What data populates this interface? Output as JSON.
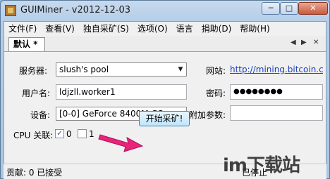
{
  "window": {
    "title": "GUIMiner - v2012-12-03",
    "min_label": "─",
    "max_label": "□",
    "close_label": "✕"
  },
  "menu": [
    "文件(F)",
    "查看(V)",
    "独自采矿(S)",
    "选项(O)",
    "语言",
    "捐助(D)",
    "帮助(H)"
  ],
  "tab": {
    "label": "默认 *",
    "prev": "◀",
    "next": "▶",
    "close": "✕"
  },
  "form": {
    "server_label": "服务器:",
    "server_value": "slush's pool",
    "website_label": "网站:",
    "website_value": "http://mining.bitcoin.cz",
    "username_label": "用户名:",
    "username_value": "ldjzll.worker1",
    "password_label": "密码:",
    "password_value": "●●●●●●●●",
    "device_label": "设备:",
    "device_value": "[0-0] GeForce 8400M GS",
    "extra_label": "附加参数:",
    "extra_value": "",
    "cpu_label": "CPU 关联:",
    "cpu0_label": "0",
    "cpu1_label": "1",
    "start_button": "开始采矿!"
  },
  "status": {
    "left": "贡献: 0 已接受",
    "right": "已停止"
  },
  "watermark": "im下载站",
  "colors": {
    "link": "#1a3fbf",
    "arrow": "#e8237a"
  }
}
